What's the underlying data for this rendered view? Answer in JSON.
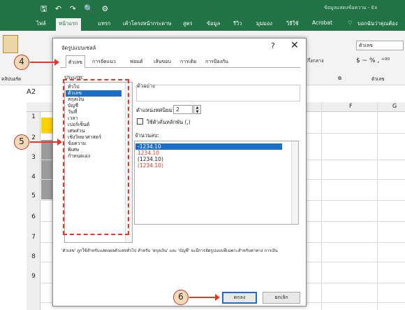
{
  "excel": {
    "doc_title": "ข้อมูลแสดงข้อความ - Ex",
    "ribbon_tabs": [
      "ไฟล์",
      "หน้าแรก",
      "แทรก",
      "เค้าโครงหน้ากระดาษ",
      "สูตร",
      "ข้อมูล",
      "รีวิว",
      "มุมมอง",
      "วิธีใช้",
      "Acrobat",
      "บอกฉันว่าคุณต้อง"
    ],
    "number_format_box": "ตัวเลข",
    "number_group_label": "ตัวเลข",
    "clipboard_label": "คลิปบอร์ด",
    "align_label": "กึ่งกลาง",
    "number_symbols": "$  ~  %  ,  ⁺⁰⁰",
    "name_box": "A2",
    "col_headers": [
      "F",
      "G"
    ],
    "row_numbers": [
      "1",
      "2",
      "3",
      "4",
      "5",
      "6",
      "7",
      "8",
      "9"
    ]
  },
  "dialog": {
    "title": "จัดรูปแบบเซลล์",
    "help": "?",
    "close": "✕",
    "tabs": [
      "ตัวเลข",
      "การจัดแนว",
      "ฟอนต์",
      "เส้นขอบ",
      "การเติม",
      "การป้องกัน"
    ],
    "category_label": "ประเภท:",
    "categories": [
      "ทั่วไป",
      "ตัวเลข",
      "สกุลเงิน",
      "บัญชี",
      "วันที่",
      "เวลา",
      "เปอร์เซ็นต์",
      "เศษส่วน",
      "เชิงวิทยาศาสตร์",
      "ข้อความ",
      "พิเศษ",
      "กำหนดเอง"
    ],
    "selected_category": "ตัวเลข",
    "sample_label": "ตัวอย่าง",
    "decimal_label": "ตำแหน่งทศนิยม:",
    "decimal_value": "2",
    "separator_label": "ใช้ตัวคั่นหลักพัน (,)",
    "negative_label": "จำนวนลบ:",
    "negative_numbers": [
      "-1234.10",
      "1234.10",
      "(1234.10)",
      "(1234.10)"
    ],
    "description": "'ตัวเลข' ถูกใช้สำหรับแสดงผลตัวเลขทั่วไป สำหรับ 'สกุลเงิน' และ 'บัญชี' จะมีการจัดรูปแบบที่เฉพาะสำหรับค่าทาง การเงิน",
    "ok": "ตกลง",
    "cancel": "ยกเลิก"
  },
  "callouts": [
    "4",
    "5",
    "6"
  ],
  "colors": {
    "excel_green": "#217346",
    "accent_red": "#e03a2b",
    "selection_blue": "#1c6fc8",
    "yellow_cell": "#ffd200"
  }
}
